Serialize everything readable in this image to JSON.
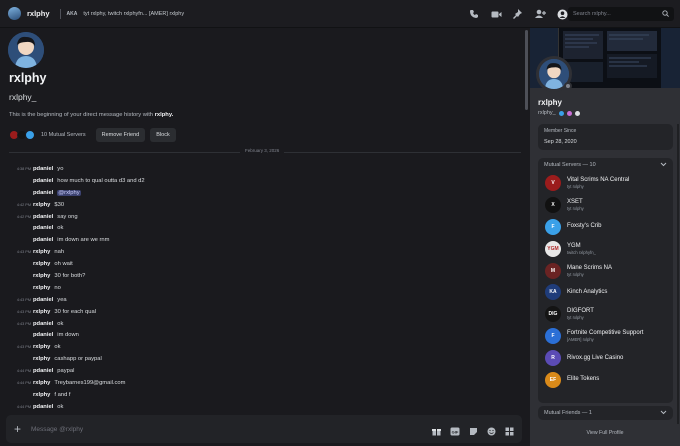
{
  "header": {
    "title": "rxlphy",
    "tag": "AKA",
    "status": "tyt rxlphy, twitch rxlphyfn... [AMER] rxlphy",
    "search_placeholder": "Search rxlphy...",
    "icons": [
      "call-icon",
      "video-icon",
      "pin-icon",
      "add-friend-icon",
      "profile-icon"
    ]
  },
  "profile": {
    "display_name": "rxlphy",
    "username": "rxlphy_",
    "desc_prefix": "This is the beginning of your direct message history with ",
    "desc_name": "rxlphy.",
    "mutual_servers": "10 Mutual Servers",
    "remove_friend": "Remove Friend",
    "block": "Block"
  },
  "date_divider": "February 3, 2026",
  "messages": [
    {
      "time": "4:38 PM",
      "author": "pdaniel",
      "text": "yo"
    },
    {
      "time": "",
      "author": "pdaniel",
      "text": "how much to qual outta d3 and d2"
    },
    {
      "time": "",
      "author": "pdaniel",
      "text": "",
      "mention": "@rxlphy"
    },
    {
      "time": "4:42 PM",
      "author": "rxlphy",
      "text": "$30"
    },
    {
      "time": "4:42 PM",
      "author": "pdaniel",
      "text": "say ong"
    },
    {
      "time": "",
      "author": "pdaniel",
      "text": "ok"
    },
    {
      "time": "",
      "author": "pdaniel",
      "text": "im down are we rnm"
    },
    {
      "time": "4:43 PM",
      "author": "rxlphy",
      "text": "nah"
    },
    {
      "time": "",
      "author": "rxlphy",
      "text": "oh wait"
    },
    {
      "time": "",
      "author": "rxlphy",
      "text": "30 for both?"
    },
    {
      "time": "",
      "author": "rxlphy",
      "text": "no"
    },
    {
      "time": "4:43 PM",
      "author": "pdaniel",
      "text": "yea"
    },
    {
      "time": "4:43 PM",
      "author": "rxlphy",
      "text": "30 for each qual"
    },
    {
      "time": "4:43 PM",
      "author": "pdaniel",
      "text": "ok"
    },
    {
      "time": "",
      "author": "pdaniel",
      "text": "im down"
    },
    {
      "time": "4:43 PM",
      "author": "rxlphy",
      "text": "ok"
    },
    {
      "time": "",
      "author": "rxlphy",
      "text": "cashapp or paypal"
    },
    {
      "time": "4:44 PM",
      "author": "pdaniel",
      "text": "paypal"
    },
    {
      "time": "4:44 PM",
      "author": "rxlphy",
      "text": "Treybarnes199@gmail.com"
    },
    {
      "time": "",
      "author": "rxlphy",
      "text": "f and f"
    },
    {
      "time": "4:44 PM",
      "author": "pdaniel",
      "text": "ok"
    },
    {
      "time": "",
      "author": "pdaniel",
      "text": "i will"
    }
  ],
  "composer": {
    "placeholder": "Message @rxlphy",
    "icons": [
      "gift-icon",
      "gif-icon",
      "sticker-icon",
      "emoji-icon",
      "apps-icon"
    ]
  },
  "panel": {
    "display_name": "rxlphy",
    "username": "rxlphy_",
    "member_since_label": "Member Since",
    "member_since": "Sep 28, 2020",
    "mutual_servers_label": "Mutual Servers — 10",
    "servers": [
      {
        "name": "Vital Scrims NA Central",
        "sub": "tyt rxlphy",
        "color": "#9b1c1c",
        "abbr": "V"
      },
      {
        "name": "XSET",
        "sub": "tyt rxlphy",
        "color": "#111111",
        "abbr": "X"
      },
      {
        "name": "Foxsty's Crib",
        "sub": "",
        "color": "#3aa0e8",
        "abbr": "F"
      },
      {
        "name": "YGM",
        "sub": "twitch rxlphyfn_",
        "color": "#e8e8e8",
        "abbr": "YGM"
      },
      {
        "name": "Mane Scrims NA",
        "sub": "tyt rxlphy",
        "color": "#6a2323",
        "abbr": "M"
      },
      {
        "name": "Kinch Analytics",
        "sub": "",
        "color": "#1f3c7a",
        "abbr": "KA"
      },
      {
        "name": "DIGFORT",
        "sub": "tyt rxlphy",
        "color": "#141414",
        "abbr": "DIG"
      },
      {
        "name": "Fortnite Competitive Support",
        "sub": "[AMER] rxlphy",
        "color": "#2b6fd6",
        "abbr": "F"
      },
      {
        "name": "Rivox.gg Live Casino",
        "sub": "",
        "color": "#5b4bb5",
        "abbr": "R"
      },
      {
        "name": "Elite Tokens",
        "sub": "",
        "color": "#d98a1a",
        "abbr": "EF"
      }
    ],
    "mutual_friends_label": "Mutual Friends — 1",
    "view_full_profile": "View Full Profile"
  }
}
